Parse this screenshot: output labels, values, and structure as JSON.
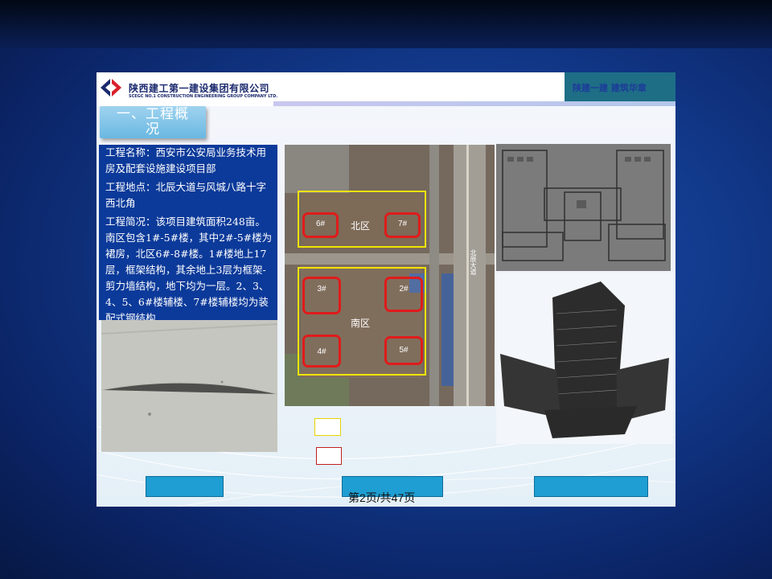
{
  "header": {
    "company_cn": "陕西建工第一建设集团有限公司",
    "company_en": "SCEGC NO.1 CONSTRUCTION ENGINEERING GROUP COMPANY LTD.",
    "top_right_text": "陕建一建 建筑华章"
  },
  "section_title": "一、工程概况",
  "info": {
    "name": "工程名称：西安市公安局业务技术用房及配套设施建设项目部",
    "location": "工程地点：北辰大道与风城八路十字西北角",
    "summary": "工程简况：该项目建筑面积248亩。南区包含1#-5#楼，其中2#-5#楼为裙房，北区6#-8#楼。1#楼地上17层，框架结构，其余地上3层为框架-剪力墙结构，地下均为一层。2、3、4、5、6#楼辅楼、7#楼辅楼均为装配式钢结构"
  },
  "map": {
    "north_zone_label": "北区",
    "south_zone_label": "南区",
    "road_label": "北辰大道",
    "markers": {
      "b6": "6#",
      "b7": "7#",
      "b3": "3#",
      "b2": "2#",
      "b4": "4#",
      "b5": "5#"
    }
  },
  "colors": {
    "zone_outline": "#f2e300",
    "building_outline": "#e01b1b",
    "info_bg": "#0c3a9a",
    "button": "#1e9ed2"
  },
  "footer": {
    "page_indicator": "第2页/共47页"
  }
}
